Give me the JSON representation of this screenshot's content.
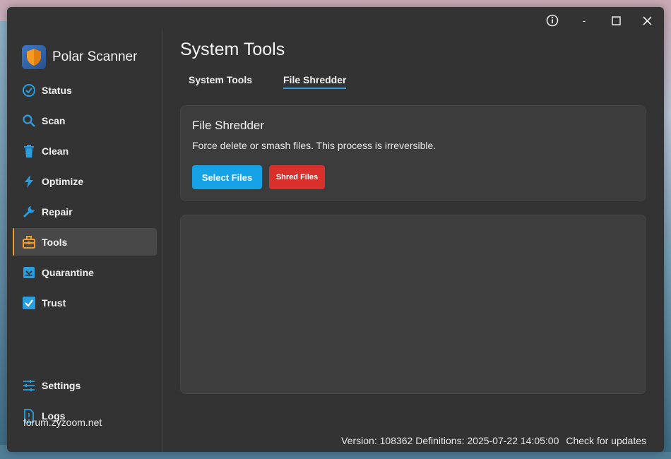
{
  "window": {
    "controls": {
      "info": "ⓘ",
      "minimize": "-",
      "maximize": "☐",
      "close": "✕"
    }
  },
  "brand": {
    "title": "Polar Scanner",
    "icon": "shield-logo-icon"
  },
  "sidebar": {
    "items": [
      {
        "label": "Status",
        "icon": "check-circle-icon"
      },
      {
        "label": "Scan",
        "icon": "search-icon"
      },
      {
        "label": "Clean",
        "icon": "trash-icon"
      },
      {
        "label": "Optimize",
        "icon": "lightning-icon"
      },
      {
        "label": "Repair",
        "icon": "wrench-icon"
      },
      {
        "label": "Tools",
        "icon": "toolbox-icon",
        "active": true
      },
      {
        "label": "Quarantine",
        "icon": "quarantine-box-icon"
      },
      {
        "label": "Trust",
        "icon": "checkbox-icon"
      }
    ],
    "bottom_items": [
      {
        "label": "Settings",
        "icon": "sliders-icon"
      },
      {
        "label": "Logs",
        "icon": "log-file-icon"
      }
    ],
    "footer_link": "forum.zyzoom.net"
  },
  "main": {
    "title": "System Tools",
    "tabs": [
      {
        "label": "System Tools",
        "active": false
      },
      {
        "label": "File Shredder",
        "active": true
      }
    ],
    "card": {
      "title": "File Shredder",
      "description": "Force delete or smash files. This process is irreversible.",
      "select_button": "Select Files",
      "shred_button": "Shred Files"
    }
  },
  "status_bar": {
    "version_text": "Version: 108362 Definitions: 2025-07-22 14:05:00",
    "update_link": "Check for updates"
  },
  "colors": {
    "accent_blue": "#15a2e6",
    "danger_red": "#d9302c",
    "active_marker": "#f29b2c",
    "icon_blue": "#2a9fe0"
  }
}
